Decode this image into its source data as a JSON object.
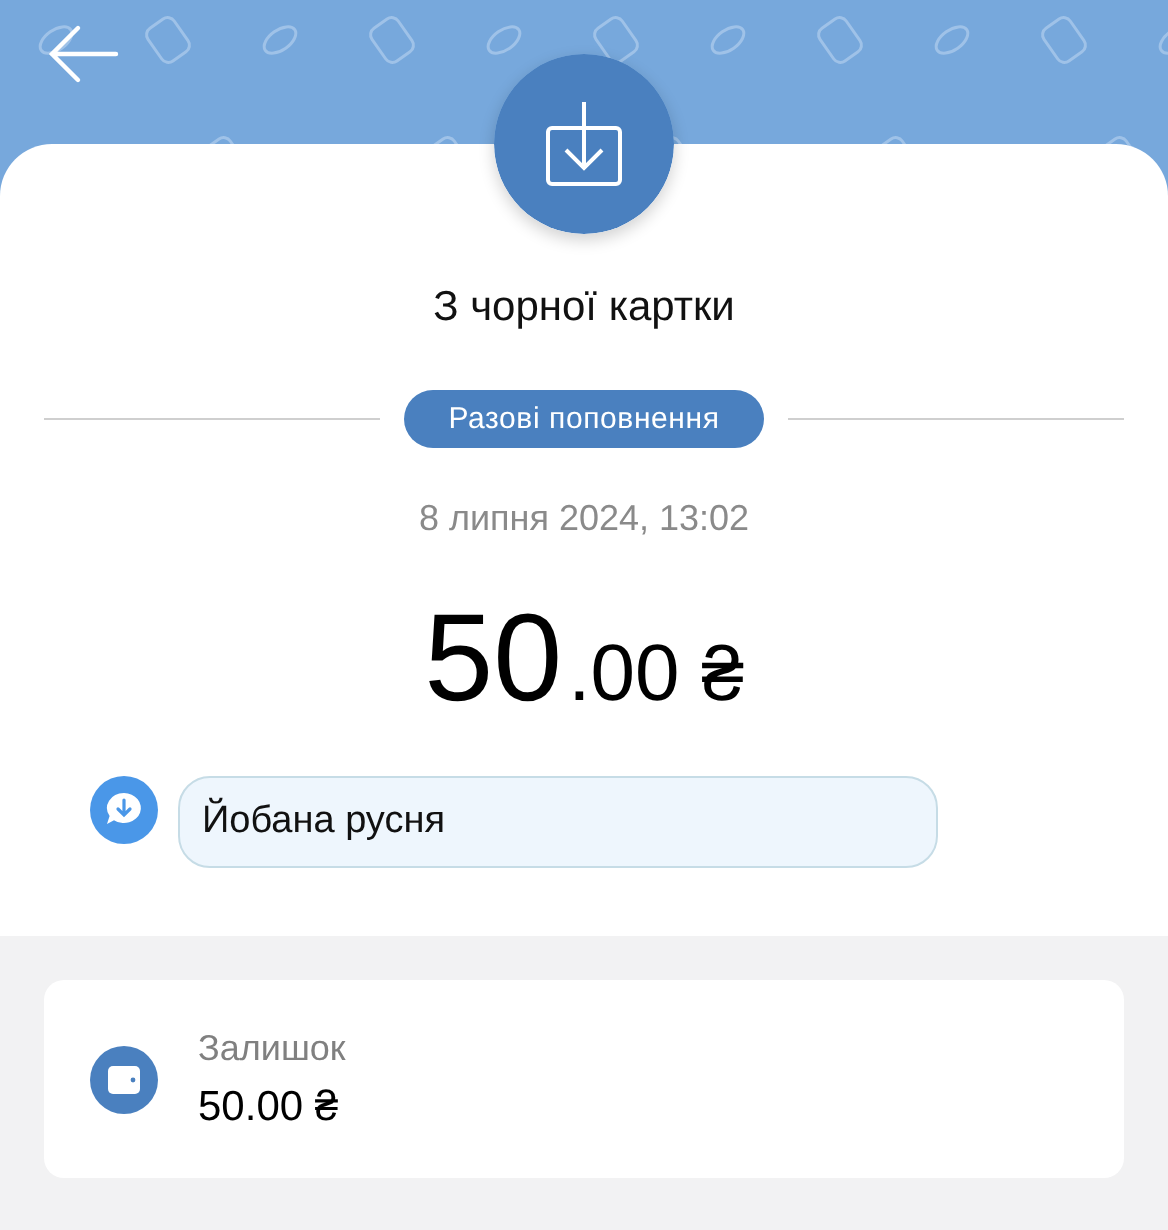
{
  "title": "З чорної картки",
  "badge": "Разові поповнення",
  "date": "8 липня 2024, 13:02",
  "amount": {
    "integer": "50",
    "fraction": ".00",
    "currency": "₴"
  },
  "comment": "Йобана русня",
  "balance": {
    "label": "Залишок",
    "value": "50.00 ₴"
  }
}
